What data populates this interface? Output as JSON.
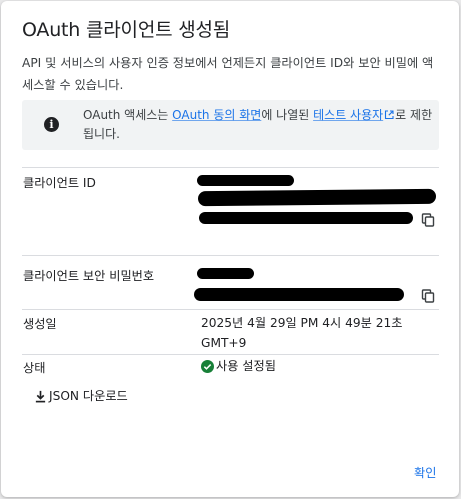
{
  "dialog": {
    "title": "OAuth 클라이언트 생성됨",
    "description": "API 및 서비스의 사용자 인증 정보에서 언제든지 클라이언트 ID와 보안 비밀에 액세스할 수 있습니다."
  },
  "info_notice": {
    "text_before": "OAuth 액세스는 ",
    "link_consent": "OAuth 동의 화면",
    "text_middle": "에 나열된 ",
    "link_test_users": "테스트 사용자",
    "text_after": "로 제한됩니다.",
    "icon": "info-icon"
  },
  "fields": {
    "client_id": {
      "label": "클라이언트 ID",
      "value_redacted": true,
      "copy_icon": "copy-icon"
    },
    "client_secret": {
      "label": "클라이언트 보안 비밀번호",
      "value_redacted": true,
      "copy_icon": "copy-icon"
    },
    "created": {
      "label": "생성일",
      "value": "2025년 4월 29일 PM 4시 49분 21초 GMT+9"
    },
    "status": {
      "label": "상태",
      "value": "사용 설정됨",
      "icon": "check-circle-icon",
      "color": "#188038"
    }
  },
  "actions": {
    "download_label": "JSON 다운로드",
    "download_icon": "download-icon",
    "confirm_label": "확인"
  },
  "colors": {
    "accent": "#1a73e8",
    "info_bg": "#f1f3f4",
    "success": "#188038"
  }
}
